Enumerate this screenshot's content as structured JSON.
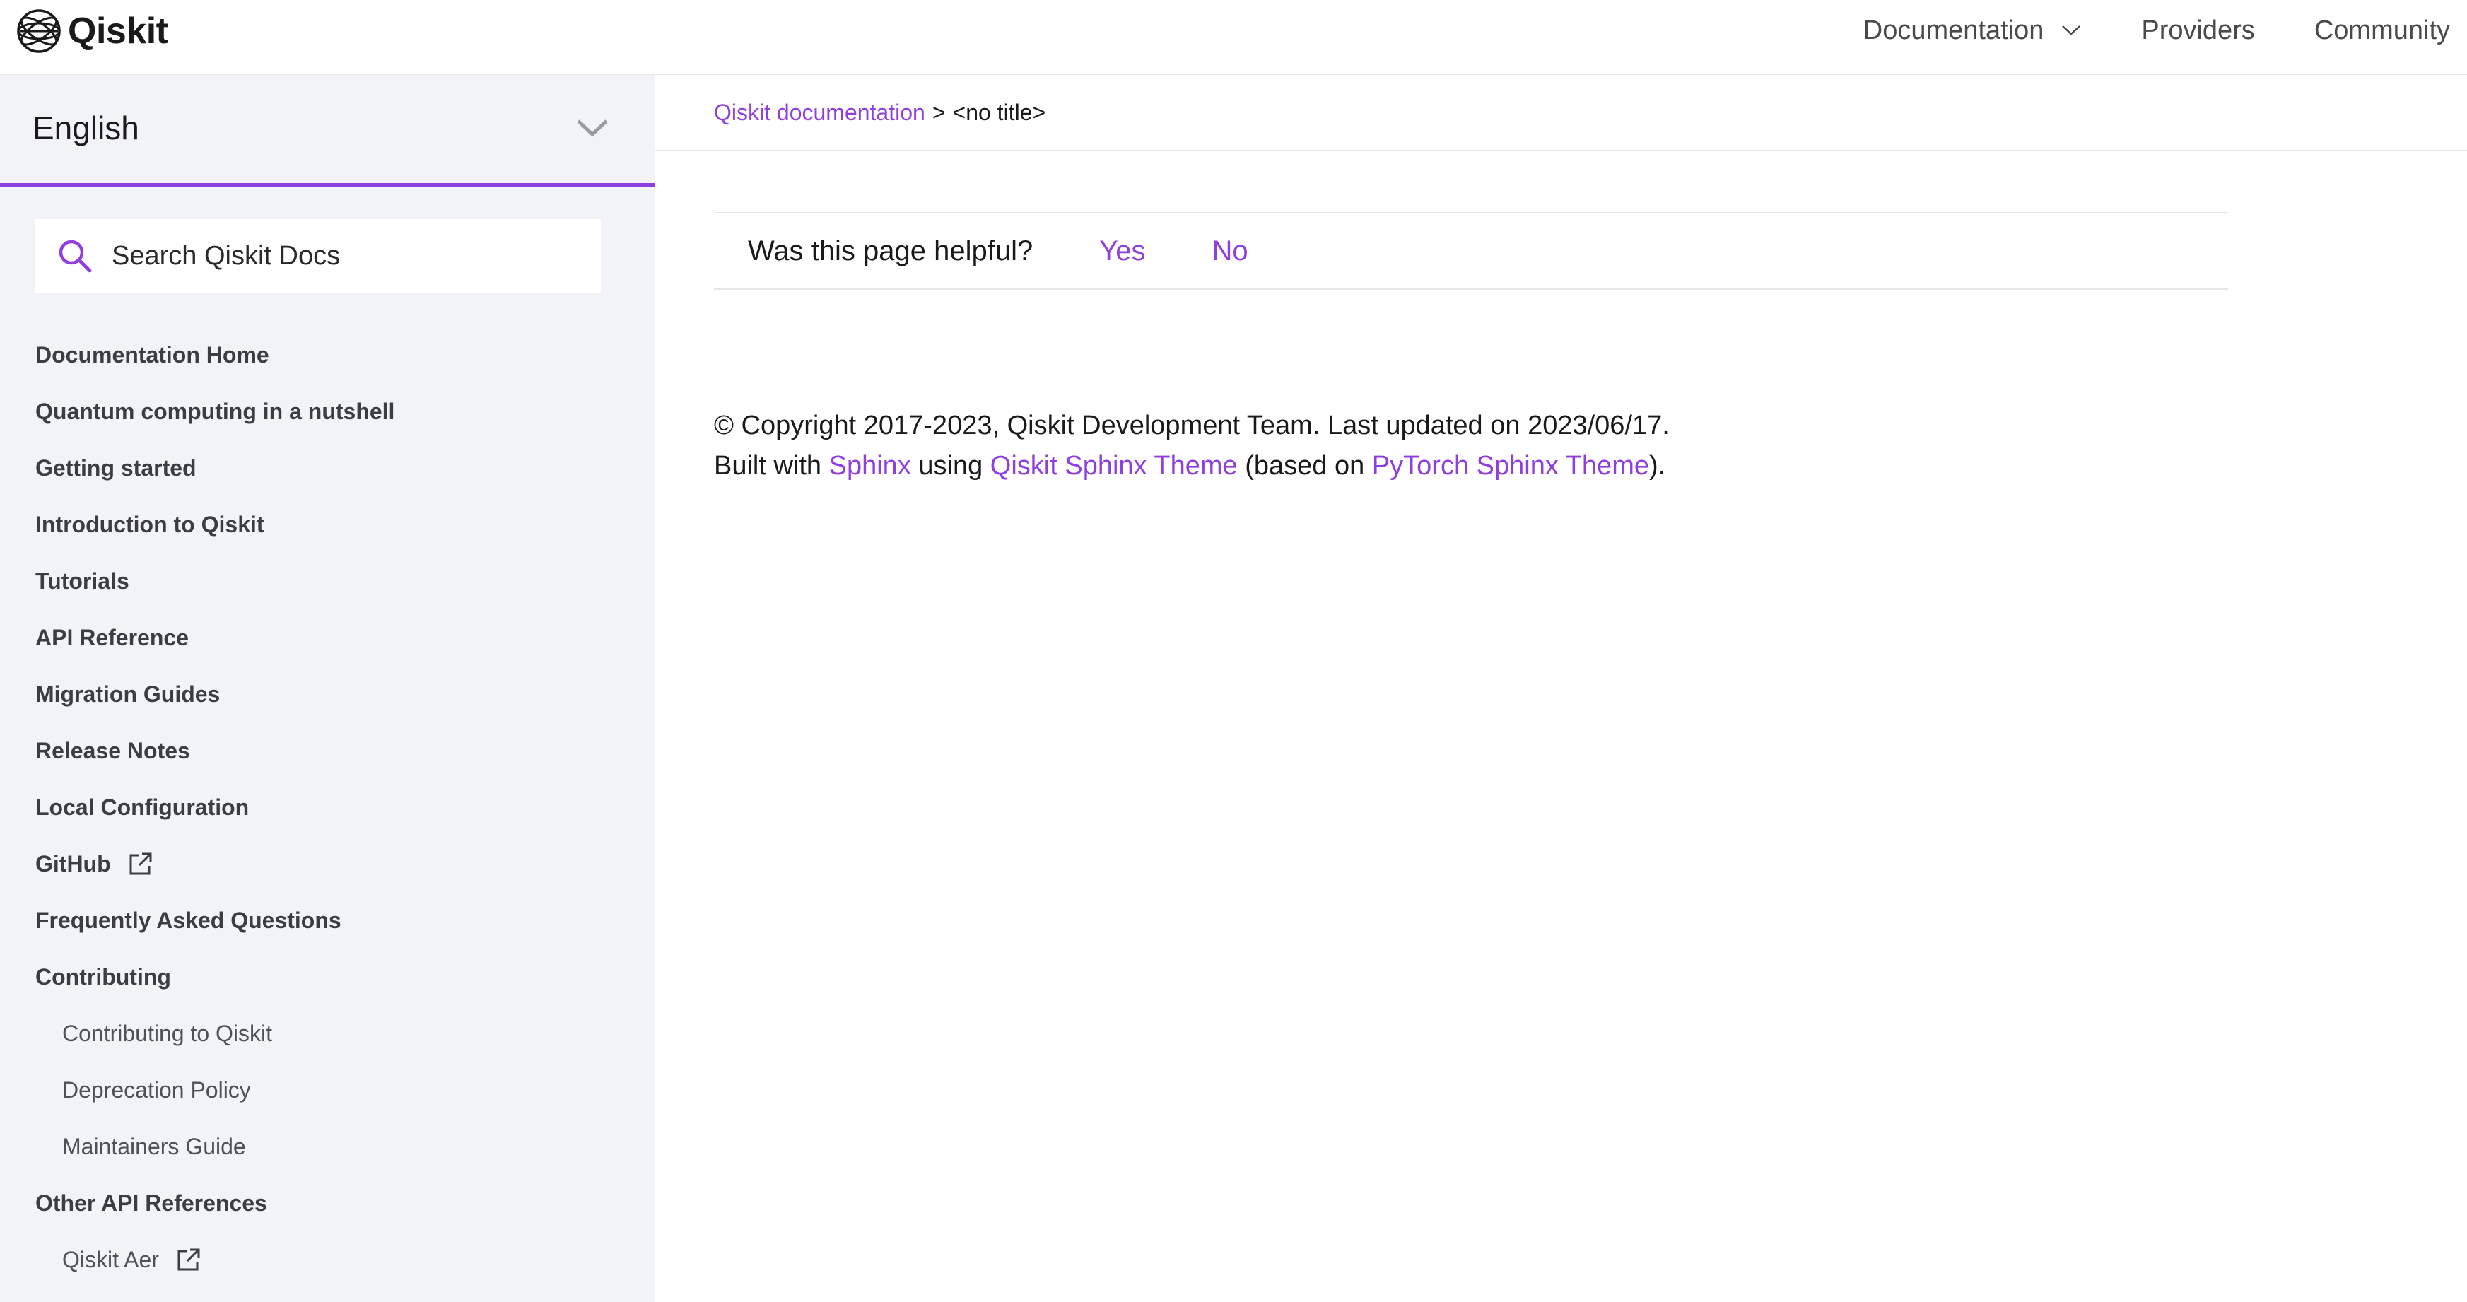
{
  "header": {
    "logo_text": "Qiskit",
    "nav": [
      {
        "label": "Documentation",
        "has_dropdown": true
      },
      {
        "label": "Providers"
      },
      {
        "label": "Community"
      }
    ]
  },
  "sidebar": {
    "language": "English",
    "search": {
      "placeholder": "Search Qiskit Docs"
    },
    "items": [
      {
        "label": "Documentation Home",
        "level": 1
      },
      {
        "label": "Quantum computing in a nutshell",
        "level": 1
      },
      {
        "label": "Getting started",
        "level": 1
      },
      {
        "label": "Introduction to Qiskit",
        "level": 1
      },
      {
        "label": "Tutorials",
        "level": 1
      },
      {
        "label": "API Reference",
        "level": 1
      },
      {
        "label": "Migration Guides",
        "level": 1
      },
      {
        "label": "Release Notes",
        "level": 1
      },
      {
        "label": "Local Configuration",
        "level": 1
      },
      {
        "label": "GitHub",
        "level": 1,
        "external": true
      },
      {
        "label": "Frequently Asked Questions",
        "level": 1
      },
      {
        "label": "Contributing",
        "level": 1
      },
      {
        "label": "Contributing to Qiskit",
        "level": 2
      },
      {
        "label": "Deprecation Policy",
        "level": 2
      },
      {
        "label": "Maintainers Guide",
        "level": 2
      },
      {
        "label": "Other API References",
        "level": 1
      },
      {
        "label": "Qiskit Aer",
        "level": 2,
        "external": true
      }
    ]
  },
  "breadcrumb": {
    "root": "Qiskit documentation",
    "separator": ">",
    "current": "<no title>"
  },
  "feedback": {
    "question": "Was this page helpful?",
    "yes": "Yes",
    "no": "No"
  },
  "footer": {
    "copyright": "© Copyright 2017-2023, Qiskit Development Team. Last updated on 2023/06/17.",
    "built_with": "Built with",
    "sphinx": "Sphinx",
    "using": "using",
    "theme": "Qiskit Sphinx Theme",
    "based_on": "(based on",
    "pytorch_theme": "PyTorch Sphinx Theme",
    "close": ")."
  },
  "colors": {
    "accent": "#8f3fe0",
    "sidebar_bg": "#f2f3f7",
    "text": "#1a1a1a"
  }
}
